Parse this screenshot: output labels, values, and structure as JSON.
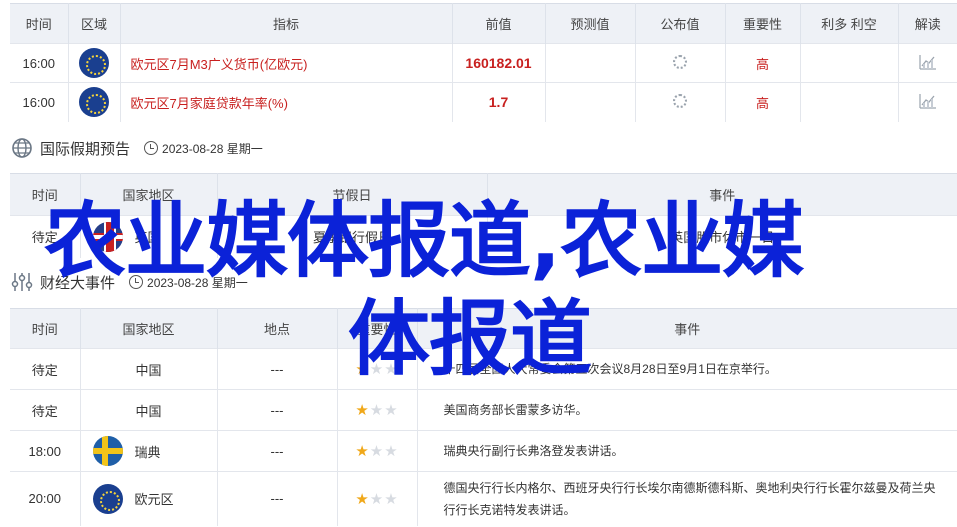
{
  "top_table": {
    "headers": [
      "时间",
      "区域",
      "指标",
      "前值",
      "预测值",
      "公布值",
      "重要性",
      "利多 利空",
      "解读"
    ],
    "rows": [
      {
        "time": "16:00",
        "region_flag": "eu-flag-icon",
        "indicator": "欧元区7月M3广义货币(亿欧元)",
        "previous": "160182.01",
        "forecast": "",
        "published_icon": "loading-spinner-icon",
        "importance": "高",
        "bias": "",
        "interpret_icon": "chart-icon"
      },
      {
        "time": "16:00",
        "region_flag": "eu-flag-icon",
        "indicator": "欧元区7月家庭贷款年率(%)",
        "previous": "1.7",
        "forecast": "",
        "published_icon": "loading-spinner-icon",
        "importance": "高",
        "bias": "",
        "interpret_icon": "chart-icon"
      }
    ]
  },
  "holiday_section": {
    "title": "国际假期预告",
    "date": "2023-08-28 星期一",
    "headers": [
      "时间",
      "国家地区",
      "节假日",
      "事件"
    ],
    "rows": [
      {
        "time": "待定",
        "country": "英国",
        "holiday": "夏季银行假日",
        "event": "英国股市休市一日"
      }
    ]
  },
  "events_section": {
    "title": "财经大事件",
    "date": "2023-08-28 星期一",
    "headers": [
      "时间",
      "国家地区",
      "地点",
      "重要性",
      "事件"
    ],
    "rows": [
      {
        "time": "待定",
        "country": "中国",
        "flag": "",
        "place": "---",
        "stars": 1,
        "event": "十四届全国人大常委会第五次会议8月28日至9月1日在京举行。"
      },
      {
        "time": "待定",
        "country": "中国",
        "flag": "",
        "place": "---",
        "stars": 1,
        "event": "美国商务部长雷蒙多访华。"
      },
      {
        "time": "18:00",
        "country": "瑞典",
        "flag": "sweden-flag-icon",
        "place": "---",
        "stars": 1,
        "event": "瑞典央行副行长弗洛登发表讲话。"
      },
      {
        "time": "20:00",
        "country": "欧元区",
        "flag": "eu-flag-icon",
        "place": "---",
        "stars": 1,
        "event": "德国央行行长内格尔、西班牙央行行长埃尔南德斯德科斯、奥地利央行行长霍尔兹曼及荷兰央行行长克诺特发表讲话。"
      }
    ]
  },
  "watermark": {
    "line1": "农业媒体报道,农业媒",
    "line2": "体报道"
  },
  "colors": {
    "header_bg": "#eef1f6",
    "accent_red": "#c8201f",
    "star_on": "#f0a81a",
    "watermark_blue": "#0b22d8"
  }
}
